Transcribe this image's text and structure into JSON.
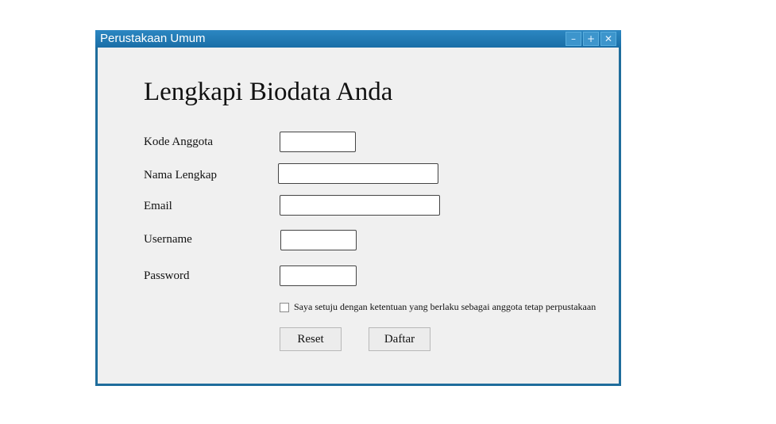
{
  "window": {
    "title": "Perustakaan Umum",
    "controls": {
      "minimize": "–",
      "maximize": "+",
      "close": "✕"
    }
  },
  "form": {
    "heading": "Lengkapi Biodata Anda",
    "fields": {
      "kode_anggota": {
        "label": "Kode Anggota",
        "value": ""
      },
      "nama_lengkap": {
        "label": "Nama Lengkap",
        "value": ""
      },
      "email": {
        "label": "Email",
        "value": ""
      },
      "username": {
        "label": "Username",
        "value": ""
      },
      "password": {
        "label": "Password",
        "value": ""
      }
    },
    "agreement": {
      "text": "Saya setuju dengan ketentuan yang berlaku sebagai anggota tetap perpustakaan",
      "checked": false
    },
    "buttons": {
      "reset": "Reset",
      "daftar": "Daftar"
    }
  },
  "colors": {
    "titlebar": "#1f6d9c",
    "window_bg": "#f0f0f0"
  }
}
